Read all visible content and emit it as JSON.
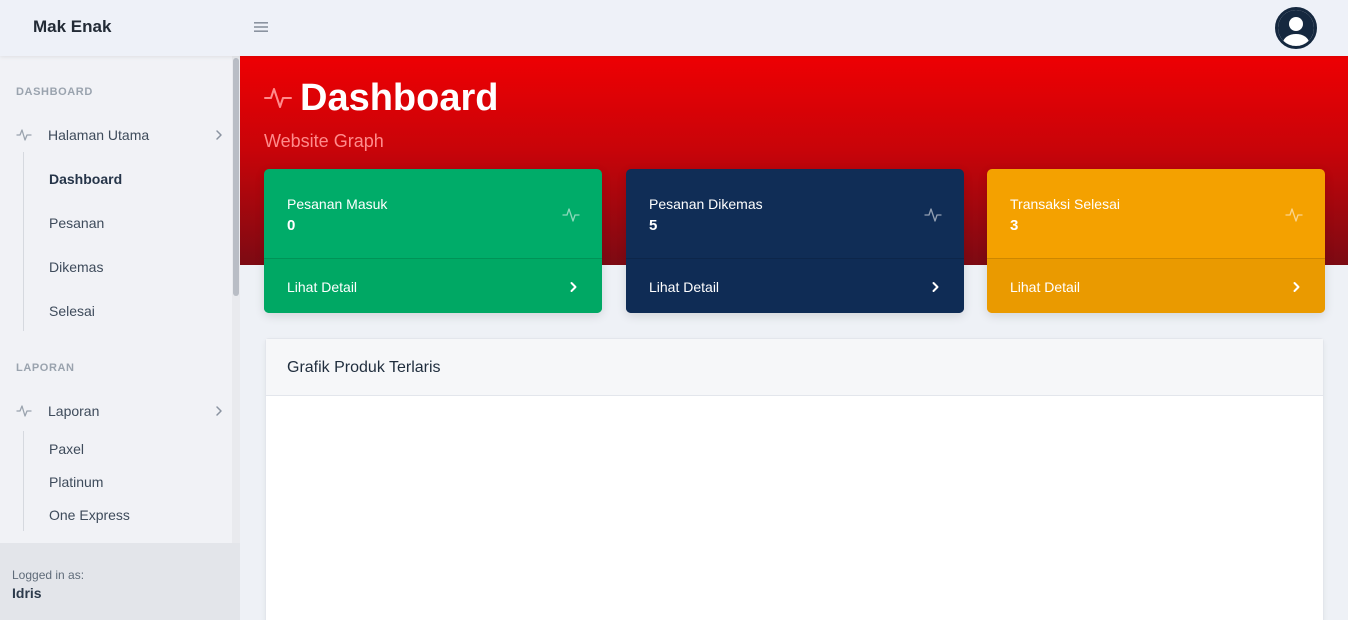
{
  "app": {
    "brand": "Mak Enak"
  },
  "header": {
    "menu_icon": "hamburger-icon",
    "avatar_icon": "user-avatar-icon"
  },
  "sidebar": {
    "sections": [
      {
        "heading": "DASHBOARD",
        "group": {
          "label": "Halaman Utama",
          "icon": "activity-icon",
          "items": [
            {
              "label": "Dashboard",
              "active": true
            },
            {
              "label": "Pesanan",
              "active": false
            },
            {
              "label": "Dikemas",
              "active": false
            },
            {
              "label": "Selesai",
              "active": false
            }
          ]
        }
      },
      {
        "heading": "LAPORAN",
        "group": {
          "label": "Laporan",
          "icon": "activity-icon",
          "items": [
            {
              "label": "Paxel",
              "active": false
            },
            {
              "label": "Platinum",
              "active": false
            },
            {
              "label": "One Express",
              "active": false
            }
          ]
        }
      }
    ],
    "footer": {
      "label": "Logged in as:",
      "user": "Idris"
    }
  },
  "page": {
    "title": "Dashboard",
    "subtitle": "Website Graph",
    "title_icon": "activity-icon"
  },
  "cards": [
    {
      "title": "Pesanan Masuk",
      "value": "0",
      "link": "Lihat Detail",
      "color": "#00ac69",
      "foot_color": "#00a864"
    },
    {
      "title": "Pesanan Dikemas",
      "value": "5",
      "link": "Lihat Detail",
      "color": "#102d56",
      "foot_color": "#0f2c55"
    },
    {
      "title": "Transaksi Selesai",
      "value": "3",
      "link": "Lihat Detail",
      "color": "#f4a100",
      "foot_color": "#ea9a00"
    }
  ],
  "chart_panel": {
    "title": "Grafik Produk Terlaris"
  },
  "colors": {
    "hero_top": "#ee0003",
    "hero_bottom": "#7c0a13",
    "sidebar_bg": "#f1f2f6",
    "navy": "#15283f"
  }
}
